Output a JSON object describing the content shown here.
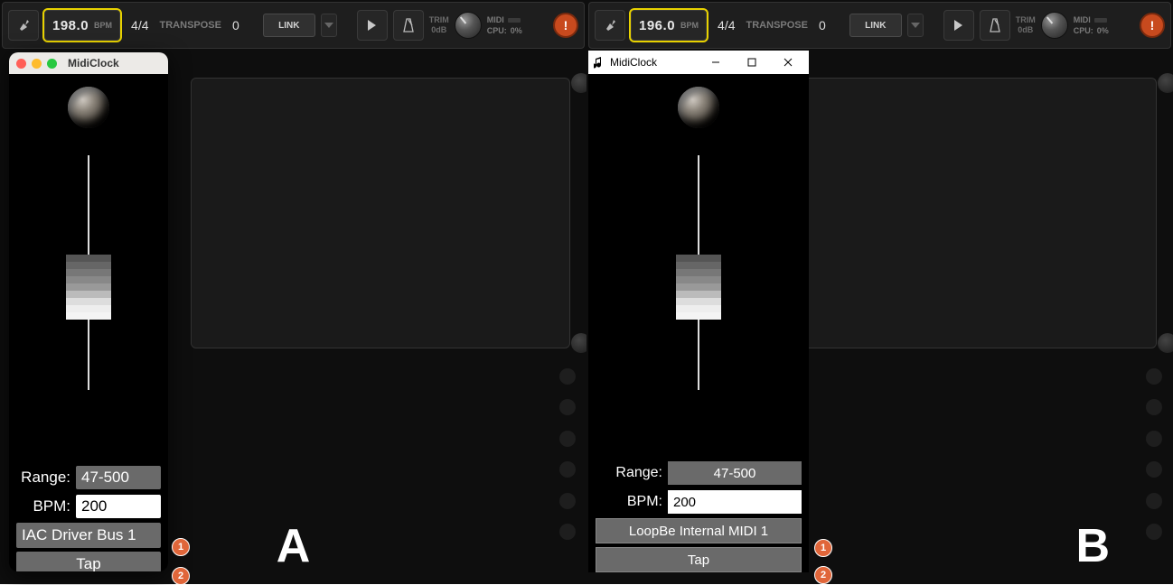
{
  "panelA": {
    "letter": "A",
    "toolbar": {
      "bpm_value": "198.0",
      "bpm_label": "BPM",
      "timesig": "4/4",
      "transpose_label": "TRANSPOSE",
      "transpose_value": "0",
      "link_label": "LINK",
      "trim_label": "TRIM",
      "trim_value": "0dB",
      "midi_label": "MIDI",
      "cpu_label": "CPU:",
      "cpu_value": "0%"
    },
    "midiclock": {
      "title": "MidiClock",
      "range_label": "Range:",
      "range_value": "47-500",
      "bpm_label": "BPM:",
      "bpm_value": "200",
      "device": "IAC Driver Bus 1",
      "tap_label": "Tap"
    },
    "badges": {
      "b1": "1",
      "b2": "2"
    }
  },
  "panelB": {
    "letter": "B",
    "toolbar": {
      "bpm_value": "196.0",
      "bpm_label": "BPM",
      "timesig": "4/4",
      "transpose_label": "TRANSPOSE",
      "transpose_value": "0",
      "link_label": "LINK",
      "trim_label": "TRIM",
      "trim_value": "0dB",
      "midi_label": "MIDI",
      "cpu_label": "CPU:",
      "cpu_value": "0%"
    },
    "midiclock": {
      "title": "MidiClock",
      "range_label": "Range:",
      "range_value": "47-500",
      "bpm_label": "BPM:",
      "bpm_value": "200",
      "device": "LoopBe Internal MIDI 1",
      "tap_label": "Tap"
    },
    "badges": {
      "b1": "1",
      "b2": "2"
    }
  }
}
